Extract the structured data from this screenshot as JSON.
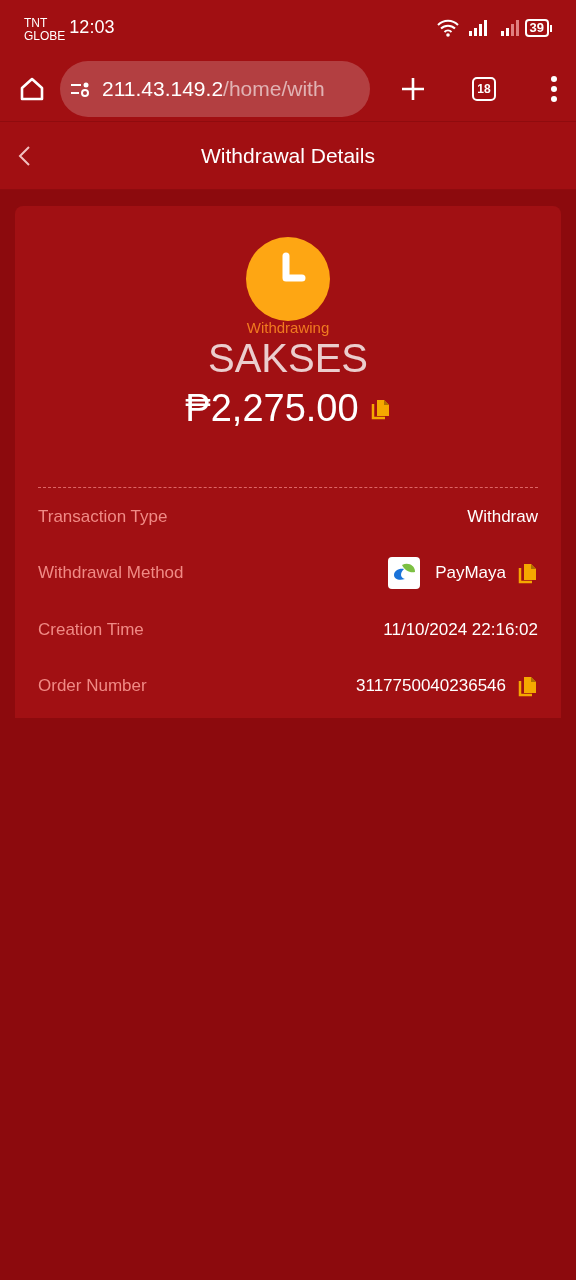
{
  "status_bar": {
    "carrier": [
      "TNT",
      "GLOBE"
    ],
    "time": "12:03",
    "battery": "39"
  },
  "browser": {
    "url_host": "211.43.149.2",
    "url_path": "/home/with",
    "tab_count": "18"
  },
  "header": {
    "title": "Withdrawal Details"
  },
  "summary": {
    "status": "Withdrawing",
    "overlay_text": "SAKSES",
    "amount": "₱2,275.00",
    "amount_copyable": true
  },
  "details": [
    {
      "label": "Transaction Type",
      "value": "Withdraw",
      "logo": false,
      "copyable": false
    },
    {
      "label": "Withdrawal Method",
      "value": "PayMaya",
      "logo": true,
      "copyable": true
    },
    {
      "label": "Creation Time",
      "value": "11/10/2024 22:16:02",
      "logo": false,
      "copyable": false
    },
    {
      "label": "Order Number",
      "value": "3117750040236546",
      "logo": false,
      "copyable": true
    }
  ]
}
